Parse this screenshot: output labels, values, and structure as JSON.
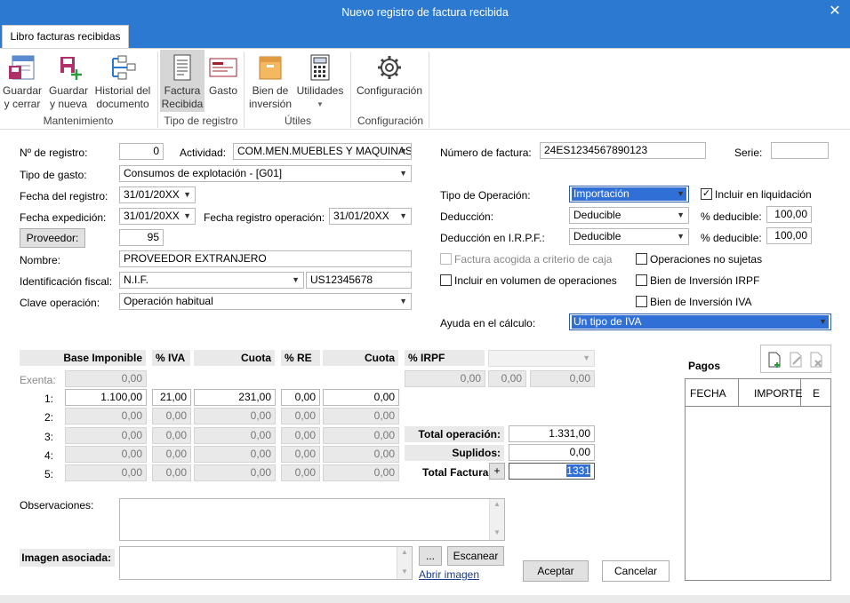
{
  "window": {
    "title": "Nuevo registro de factura recibida",
    "close": "✕"
  },
  "tab": {
    "label": "Libro facturas recibidas"
  },
  "ribbon": {
    "guardar_cerrar": [
      "Guardar",
      "y cerrar"
    ],
    "guardar_nueva": [
      "Guardar",
      "y nueva"
    ],
    "historial": [
      "Historial del",
      "documento"
    ],
    "factura_recibida": [
      "Factura",
      "Recibida"
    ],
    "gasto": "Gasto",
    "bien_inversion": [
      "Bien de",
      "inversión"
    ],
    "utilidades": "Utilidades",
    "configuracion": "Configuración",
    "groups": {
      "mantenimiento": "Mantenimiento",
      "tipo_registro": "Tipo de registro",
      "utiles": "Útiles",
      "configuracion": "Configuración"
    }
  },
  "form": {
    "num_registro_label": "Nº de registro:",
    "num_registro": "0",
    "actividad_label": "Actividad:",
    "actividad": "COM.MEN.MUEBLES Y MAQUINAS D",
    "tipo_gasto_label": "Tipo de gasto:",
    "tipo_gasto": "Consumos de explotación - [G01]",
    "fecha_registro_label": "Fecha del registro:",
    "fecha_registro": "31/01/20XX",
    "fecha_expedicion_label": "Fecha expedición:",
    "fecha_expedicion": "31/01/20XX",
    "fecha_reg_op_label": "Fecha registro operación:",
    "fecha_reg_op": "31/01/20XX",
    "proveedor_btn": "Proveedor:",
    "proveedor": "95",
    "nombre_label": "Nombre:",
    "nombre": "PROVEEDOR EXTRANJERO",
    "ident_fiscal_label": "Identificación fiscal:",
    "ident_fiscal_tipo": "N.I.F.",
    "ident_fiscal": "US12345678",
    "clave_op_label": "Clave operación:",
    "clave_op": "Operación habitual",
    "num_factura_label": "Número de factura:",
    "num_factura": "24ES1234567890123",
    "serie_label": "Serie:",
    "serie": "",
    "tipo_op_label": "Tipo de Operación:",
    "tipo_op": "Importación",
    "incluir_liq": "Incluir en liquidación",
    "deduccion_label": "Deducción:",
    "deduccion": "Deducible",
    "pct_deducible_label": "% deducible:",
    "pct_deducible": "100,00",
    "deduccion_irpf_label": "Deducción en I.R.P.F.:",
    "deduccion_irpf": "Deducible",
    "pct_deducible2": "100,00",
    "criterio_caja": "Factura acogida a criterio de caja",
    "no_sujetas": "Operaciones no sujetas",
    "volumen_op": "Incluir en  volumen de operaciones",
    "bien_irpf": "Bien de Inversión IRPF",
    "bien_iva": "Bien de Inversión IVA",
    "ayuda_label": "Ayuda en el cálculo:",
    "ayuda": "Un tipo de IVA"
  },
  "grid": {
    "headers": {
      "base": "Base Imponible",
      "iva": "% IVA",
      "cuota": "Cuota",
      "re": "% RE",
      "cuota_re": "Cuota",
      "irpf": "% IRPF"
    },
    "exenta_label": "Exenta:",
    "exenta": "0,00",
    "rows": [
      {
        "label": "1:",
        "base": "1.100,00",
        "iva": "21,00",
        "cuota": "231,00",
        "re": "0,00",
        "cuota_re": "0,00"
      },
      {
        "label": "2:",
        "base": "0,00",
        "iva": "0,00",
        "cuota": "0,00",
        "re": "0,00",
        "cuota_re": "0,00"
      },
      {
        "label": "3:",
        "base": "0,00",
        "iva": "0,00",
        "cuota": "0,00",
        "re": "0,00",
        "cuota_re": "0,00"
      },
      {
        "label": "4:",
        "base": "0,00",
        "iva": "0,00",
        "cuota": "0,00",
        "re": "0,00",
        "cuota_re": "0,00"
      },
      {
        "label": "5:",
        "base": "0,00",
        "iva": "0,00",
        "cuota": "0,00",
        "re": "0,00",
        "cuota_re": "0,00"
      }
    ],
    "irpf_vals": [
      "0,00",
      "0,00",
      "0,00"
    ],
    "total_op_label": "Total operación:",
    "total_op": "1.331,00",
    "suplidos_label": "Suplidos:",
    "suplidos": "0,00",
    "total_factura_label": "Total Factura:",
    "total_factura": "1331",
    "plus": "+"
  },
  "pagos": {
    "title": "Pagos",
    "cols": [
      "FECHA",
      "IMPORTE",
      "E"
    ]
  },
  "observaciones_label": "Observaciones:",
  "imagen": {
    "label": "Imagen asociada:",
    "browse": "...",
    "escanear": "Escanear",
    "abrir": "Abrir imagen"
  },
  "buttons": {
    "aceptar": "Aceptar",
    "cancelar": "Cancelar"
  },
  "colors": {
    "accent": "#2b79d0",
    "selection": "#3070d6"
  }
}
